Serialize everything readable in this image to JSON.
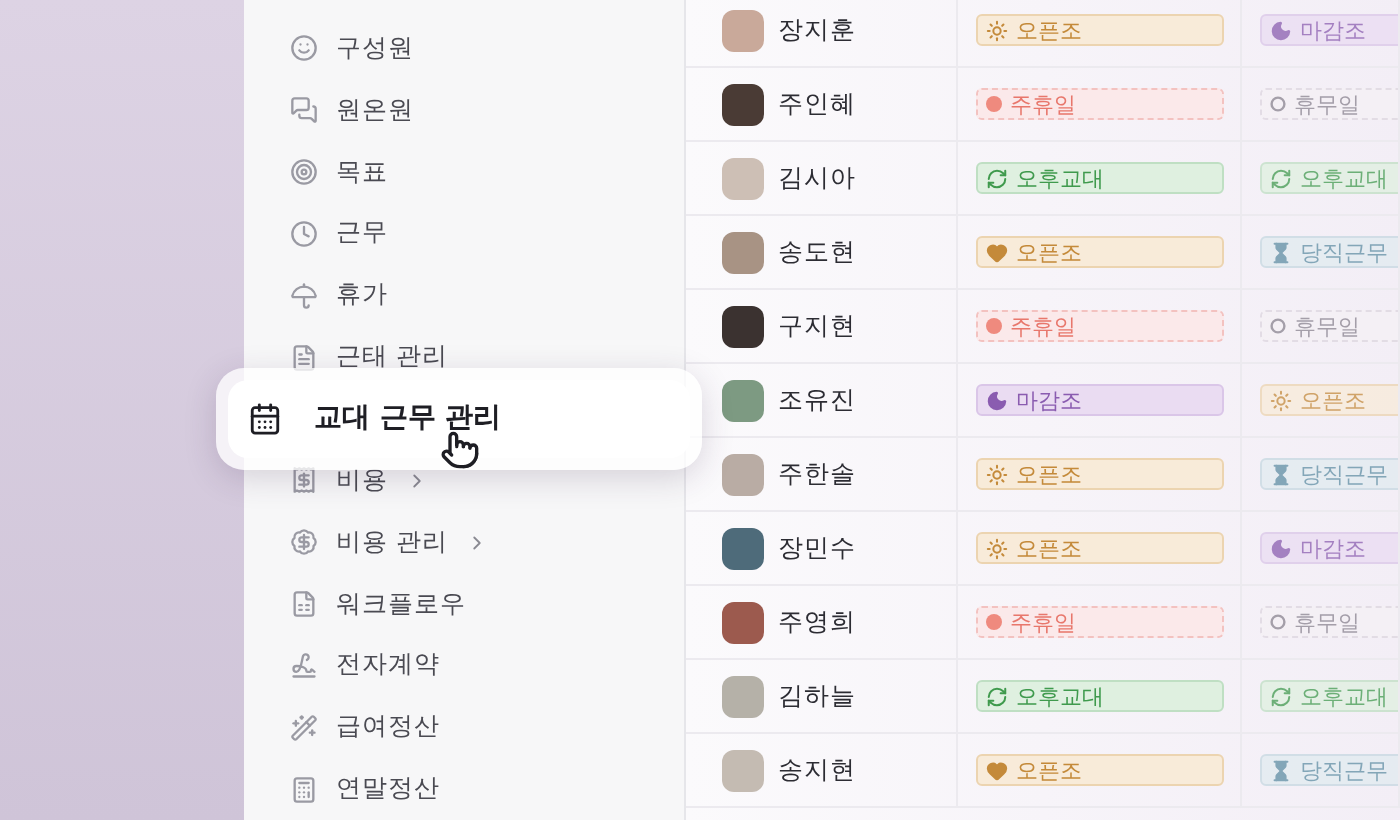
{
  "sidebar": {
    "items": [
      {
        "label": "구성원",
        "selected": false,
        "submenu": false
      },
      {
        "label": "원온원",
        "selected": false,
        "submenu": false
      },
      {
        "label": "목표",
        "selected": false,
        "submenu": false
      },
      {
        "label": "근무",
        "selected": false,
        "submenu": false
      },
      {
        "label": "휴가",
        "selected": false,
        "submenu": false
      },
      {
        "label": "근태 관리",
        "selected": false,
        "submenu": false
      },
      {
        "label": "교대 근무 관리",
        "selected": true,
        "submenu": false
      },
      {
        "label": "비용",
        "selected": false,
        "submenu": true
      },
      {
        "label": "비용 관리",
        "selected": false,
        "submenu": true
      },
      {
        "label": "워크플로우",
        "selected": false,
        "submenu": false
      },
      {
        "label": "전자계약",
        "selected": false,
        "submenu": false
      },
      {
        "label": "급여정산",
        "selected": false,
        "submenu": false
      },
      {
        "label": "연말정산",
        "selected": false,
        "submenu": false
      }
    ]
  },
  "schedule": {
    "rows": [
      {
        "name": "장지훈",
        "shifts": [
          {
            "kind": "open",
            "label": "오픈조"
          },
          {
            "kind": "closing",
            "label": "마감조"
          }
        ]
      },
      {
        "name": "주인혜",
        "shifts": [
          {
            "kind": "weekly_off",
            "label": "주휴일"
          },
          {
            "kind": "day_off",
            "label": "휴무일"
          }
        ]
      },
      {
        "name": "김시아",
        "shifts": [
          {
            "kind": "afternoon",
            "label": "오후교대"
          },
          {
            "kind": "afternoon",
            "label": "오후교대"
          }
        ]
      },
      {
        "name": "송도현",
        "shifts": [
          {
            "kind": "open_heart",
            "label": "오픈조"
          },
          {
            "kind": "duty",
            "label": "당직근무"
          }
        ]
      },
      {
        "name": "구지현",
        "shifts": [
          {
            "kind": "weekly_off",
            "label": "주휴일"
          },
          {
            "kind": "day_off",
            "label": "휴무일"
          }
        ]
      },
      {
        "name": "조유진",
        "shifts": [
          {
            "kind": "closing",
            "label": "마감조"
          },
          {
            "kind": "open",
            "label": "오픈조"
          }
        ]
      },
      {
        "name": "주한솔",
        "shifts": [
          {
            "kind": "open",
            "label": "오픈조"
          },
          {
            "kind": "duty",
            "label": "당직근무"
          }
        ]
      },
      {
        "name": "장민수",
        "shifts": [
          {
            "kind": "open",
            "label": "오픈조"
          },
          {
            "kind": "closing",
            "label": "마감조"
          }
        ]
      },
      {
        "name": "주영희",
        "shifts": [
          {
            "kind": "weekly_off",
            "label": "주휴일"
          },
          {
            "kind": "day_off",
            "label": "휴무일"
          }
        ]
      },
      {
        "name": "김하늘",
        "shifts": [
          {
            "kind": "afternoon",
            "label": "오후교대"
          },
          {
            "kind": "afternoon",
            "label": "오후교대"
          }
        ]
      },
      {
        "name": "송지현",
        "shifts": [
          {
            "kind": "open_heart",
            "label": "오픈조"
          },
          {
            "kind": "duty",
            "label": "당직근무"
          }
        ]
      }
    ]
  }
}
